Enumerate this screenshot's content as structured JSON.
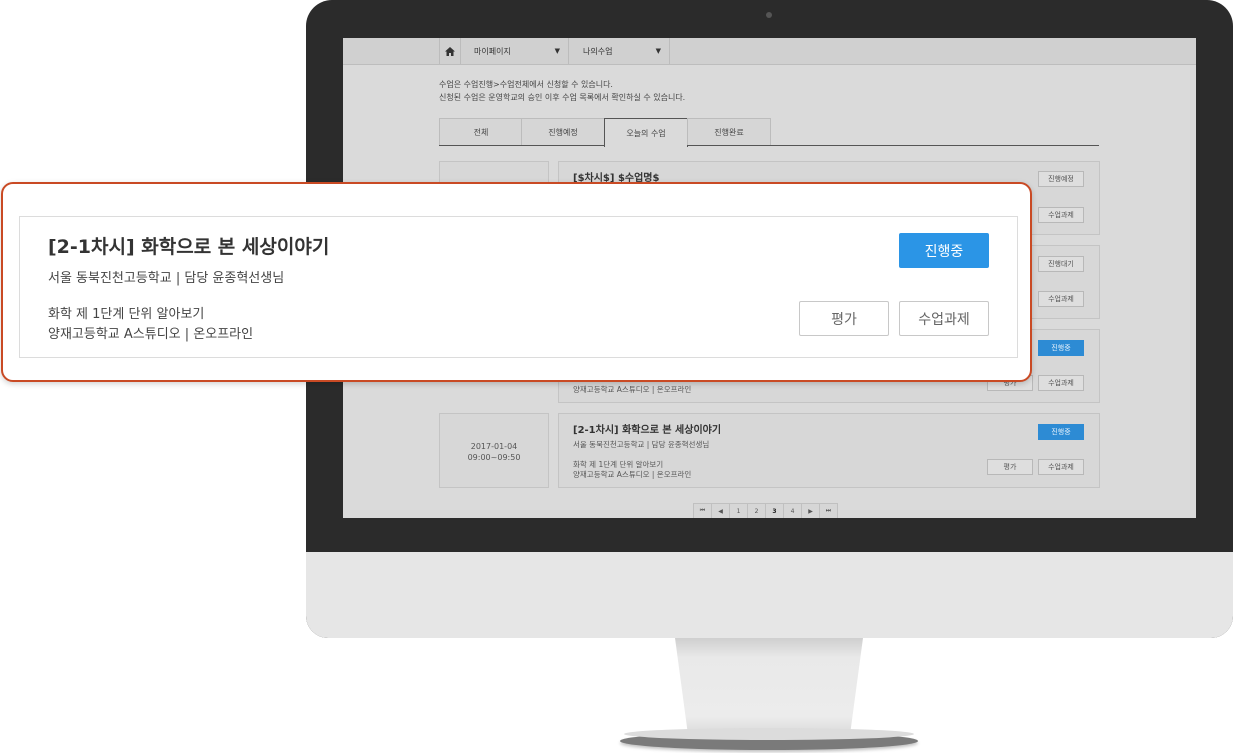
{
  "nav": {
    "dropdown1": "마이페이지",
    "dropdown2": "나의수업",
    "arrow": "▼"
  },
  "notice": {
    "line1": "수업은 수업진행>수업전체에서 신청할 수 있습니다.",
    "line2": "신청된 수업은 운영학교의 승인 이후 수업 목록에서 확인하실 수 있습니다."
  },
  "tabs": [
    "전체",
    "진행예정",
    "오늘의 수업",
    "진행완료"
  ],
  "rows": [
    {
      "date": "",
      "time": "",
      "title": "[$차시$] $수업명$",
      "school": "",
      "desc": "",
      "place": "",
      "status": "진행예정",
      "btn1": "",
      "btn2": "수업과제"
    },
    {
      "date": "",
      "time": "",
      "title": "",
      "school": "",
      "desc": "",
      "place": "",
      "status": "진행대기",
      "btn1": "",
      "btn2": "수업과제"
    },
    {
      "date": "",
      "time": "",
      "title": "",
      "school": "",
      "desc": "",
      "place": "양재고등학교 A스튜디오 | 온오프라인",
      "status": "진행중",
      "btn1": "평가",
      "btn2": "수업과제"
    },
    {
      "date": "2017-01-04",
      "time": "09:00~09:50",
      "title": "[2-1차시] 화학으로 본 세상이야기",
      "school": "서울 동북진천고등학교 | 담당 윤종혁선생님",
      "desc": "화학 제 1단계 단위 알아보기",
      "place": "양재고등학교 A스튜디오 | 온오프라인",
      "status": "진행중",
      "btn1": "평가",
      "btn2": "수업과제"
    }
  ],
  "pager": [
    "⏮",
    "◀",
    "1",
    "2",
    "3",
    "4",
    "▶",
    "⏭"
  ],
  "zoom": {
    "title": "[2-1차시] 화학으로 본 세상이야기",
    "school": "서울 동북진천고등학교 | 담당 윤종혁선생님",
    "desc1": "화학 제 1단계 단위 알아보기",
    "desc2": "양재고등학교 A스튜디오 | 온오프라인",
    "status": "진행중",
    "btn_eval": "평가",
    "btn_task": "수업과제"
  },
  "colors": {
    "accent": "#2b95e6",
    "highlight_border": "#c94a24"
  },
  "icons": {
    "home": "home-icon"
  }
}
